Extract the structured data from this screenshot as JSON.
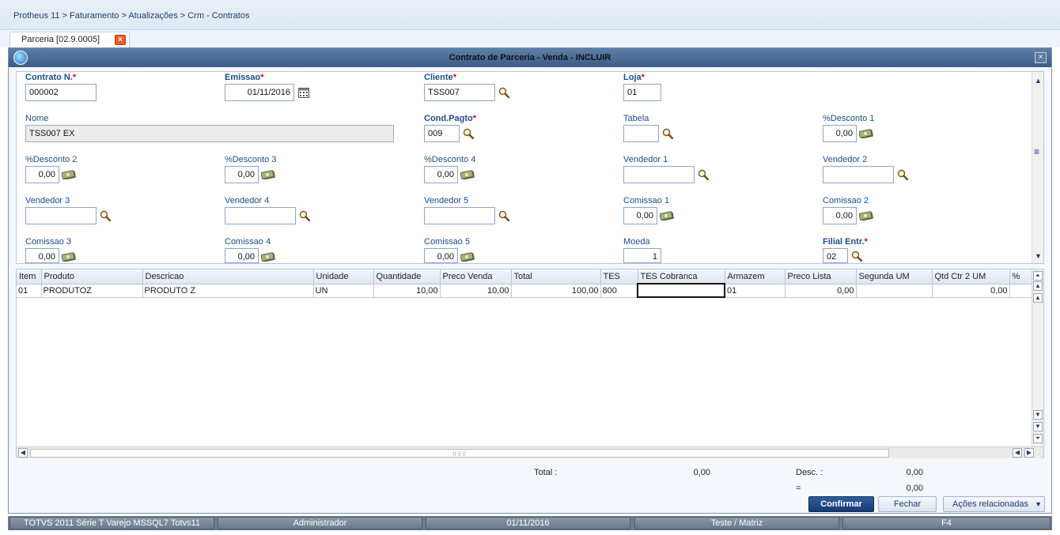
{
  "breadcrumb": "Protheus 11 > Faturamento > Atualizações > Crm - Contratos",
  "tab": {
    "label": "Parceria [02.9.0005]",
    "close": "×"
  },
  "window": {
    "title": "Contrato de Parceria - Venda - INCLUIR",
    "close": "×"
  },
  "form": {
    "contrato_label": "Contrato N.",
    "contrato_value": "000002",
    "emissao_label": "Emissao",
    "emissao_value": "01/11/2016",
    "cliente_label": "Cliente",
    "cliente_value": "TSS007",
    "loja_label": "Loja",
    "loja_value": "01",
    "nome_label": "Nome",
    "nome_value": "TSS007 EX",
    "condpagto_label": "Cond.Pagto",
    "condpagto_value": "009",
    "tabela_label": "Tabela",
    "tabela_value": "",
    "desc1_label": "%Desconto 1",
    "desc1_value": "0,00",
    "desc2_label": "%Desconto 2",
    "desc2_value": "0,00",
    "desc3_label": "%Desconto 3",
    "desc3_value": "0,00",
    "desc4_label": "%Desconto 4",
    "desc4_value": "0,00",
    "vend1_label": "Vendedor 1",
    "vend1_value": "",
    "vend2_label": "Vendedor 2",
    "vend2_value": "",
    "vend3_label": "Vendedor 3",
    "vend3_value": "",
    "vend4_label": "Vendedor 4",
    "vend4_value": "",
    "vend5_label": "Vendedor 5",
    "vend5_value": "",
    "com1_label": "Comissao 1",
    "com1_value": "0,00",
    "com2_label": "Comissao 2",
    "com2_value": "0,00",
    "com3_label": "Comissao 3",
    "com3_value": "0,00",
    "com4_label": "Comissao 4",
    "com4_value": "0,00",
    "com5_label": "Comissao 5",
    "com5_value": "0,00",
    "moeda_label": "Moeda",
    "moeda_value": "1",
    "filial_label": "Filial Entr.",
    "filial_value": "02",
    "required_mark": "*"
  },
  "grid": {
    "columns": [
      "Item",
      "Produto",
      "Descricao",
      "Unidade",
      "Quantidade",
      "Preco Venda",
      "Total",
      "TES",
      "TES Cobranca",
      "Armazem",
      "Preco Lista",
      "Segunda UM",
      "Qtd Ctr 2 UM",
      "%"
    ],
    "rows": [
      [
        "01",
        "PRODUTOZ",
        "PRODUTO Z",
        "UN",
        "10,00",
        "10,00",
        "100,00",
        "800",
        "",
        "01",
        "0,00",
        "",
        "0,00",
        ""
      ]
    ]
  },
  "totals": {
    "total_label": "Total :",
    "total_value": "0,00",
    "desc_label": "Desc. :",
    "desc_value": "0,00",
    "eq_label": "=",
    "eq_value": "0,00"
  },
  "buttons": {
    "confirmar": "Confirmar",
    "fechar": "Fechar",
    "acoes": "Ações relacionadas"
  },
  "status": [
    "TOTVS 2011 Série T Varejo MSSQL7 Totvs11",
    "Administrador",
    "01/11/2016",
    "Teste / Matriz",
    "F4"
  ],
  "colors": {
    "accent": "#1e4d87",
    "required": "#d0021b",
    "primary_button": "#16396f"
  }
}
